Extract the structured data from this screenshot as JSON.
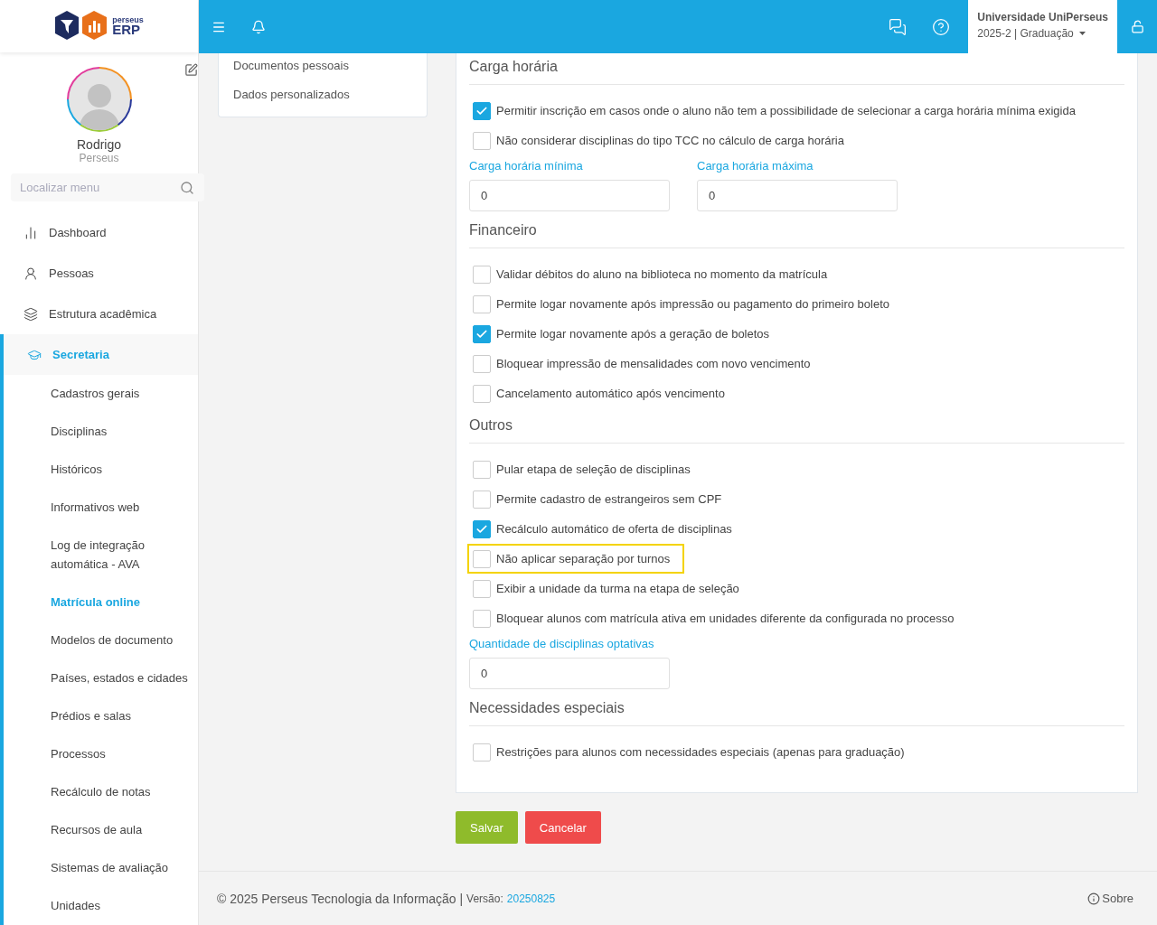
{
  "brand": {
    "small": "perseus",
    "big": "ERP"
  },
  "user": {
    "name": "Rodrigo",
    "org": "Perseus"
  },
  "search": {
    "placeholder": "Localizar menu"
  },
  "menu": [
    {
      "label": "Dashboard",
      "selected": false
    },
    {
      "label": "Pessoas",
      "selected": false
    },
    {
      "label": "Estrutura acadêmica",
      "selected": false
    },
    {
      "label": "Secretaria",
      "selected": true,
      "children": [
        {
          "label": "Cadastros gerais",
          "selected": false
        },
        {
          "label": "Disciplinas",
          "selected": false
        },
        {
          "label": "Históricos",
          "selected": false
        },
        {
          "label": "Informativos web",
          "selected": false
        },
        {
          "label": "Log de integração automática - AVA",
          "selected": false
        },
        {
          "label": "Matrícula online",
          "selected": true
        },
        {
          "label": "Modelos de documento",
          "selected": false
        },
        {
          "label": "Países, estados e cidades",
          "selected": false
        },
        {
          "label": "Prédios e salas",
          "selected": false
        },
        {
          "label": "Processos",
          "selected": false
        },
        {
          "label": "Recálculo de notas",
          "selected": false
        },
        {
          "label": "Recursos de aula",
          "selected": false
        },
        {
          "label": "Sistemas de avaliação",
          "selected": false
        },
        {
          "label": "Unidades",
          "selected": false
        }
      ]
    }
  ],
  "topbar": {
    "institution": "Universidade UniPerseus",
    "period": "2025-2 | Graduação"
  },
  "subnav": [
    {
      "label": "Documentos pessoais",
      "selected": false
    },
    {
      "label": "Dados personalizados",
      "selected": false
    }
  ],
  "sections": [
    {
      "title": "Carga horária",
      "items": [
        {
          "kind": "checkbox",
          "label": "Permitir inscrição em casos onde o aluno não tem a possibilidade de selecionar a carga horária mínima exigida",
          "checked": true,
          "highlighted": false
        },
        {
          "kind": "checkbox",
          "label": "Não considerar disciplinas do tipo TCC no cálculo de carga horária",
          "checked": false,
          "highlighted": false
        },
        {
          "kind": "fields",
          "fields": [
            {
              "label": "Carga horária mínima",
              "value": "0"
            },
            {
              "label": "Carga horária máxima",
              "value": "0"
            }
          ]
        }
      ]
    },
    {
      "title": "Financeiro",
      "items": [
        {
          "kind": "checkbox",
          "label": "Validar débitos do aluno na biblioteca no momento da matrícula",
          "checked": false,
          "highlighted": false
        },
        {
          "kind": "checkbox",
          "label": "Permite logar novamente após impressão ou pagamento do primeiro boleto",
          "checked": false,
          "highlighted": false
        },
        {
          "kind": "checkbox",
          "label": "Permite logar novamente após a geração de boletos",
          "checked": true,
          "highlighted": false
        },
        {
          "kind": "checkbox",
          "label": "Bloquear impressão de mensalidades com novo vencimento",
          "checked": false,
          "highlighted": false
        },
        {
          "kind": "checkbox",
          "label": "Cancelamento automático após vencimento",
          "checked": false,
          "highlighted": false
        }
      ]
    },
    {
      "title": "Outros",
      "items": [
        {
          "kind": "checkbox",
          "label": "Pular etapa de seleção de disciplinas",
          "checked": false,
          "highlighted": false
        },
        {
          "kind": "checkbox",
          "label": "Permite cadastro de estrangeiros sem CPF",
          "checked": false,
          "highlighted": false
        },
        {
          "kind": "checkbox",
          "label": "Recálculo automático de oferta de disciplinas",
          "checked": true,
          "highlighted": false
        },
        {
          "kind": "checkbox",
          "label": "Não aplicar separação por turnos",
          "checked": false,
          "highlighted": true
        },
        {
          "kind": "checkbox",
          "label": "Exibir a unidade da turma na etapa de seleção",
          "checked": false,
          "highlighted": false
        },
        {
          "kind": "checkbox",
          "label": "Bloquear alunos com matrícula ativa em unidades diferente da configurada no processo",
          "checked": false,
          "highlighted": false
        },
        {
          "kind": "fields",
          "fields": [
            {
              "label": "Quantidade de disciplinas optativas",
              "value": "0"
            }
          ]
        }
      ]
    },
    {
      "title": "Necessidades especiais",
      "items": [
        {
          "kind": "checkbox",
          "label": "Restrições para alunos com necessidades especiais (apenas para graduação)",
          "checked": false,
          "highlighted": false
        }
      ]
    }
  ],
  "buttons": [
    {
      "label": "Salvar",
      "kind": "primary"
    },
    {
      "label": "Cancelar",
      "kind": "danger"
    }
  ],
  "footer": {
    "copyright": "© 2025 Perseus Tecnologia da Informação |",
    "version_label": "Versão:",
    "version": "20250825",
    "about": "Sobre"
  }
}
